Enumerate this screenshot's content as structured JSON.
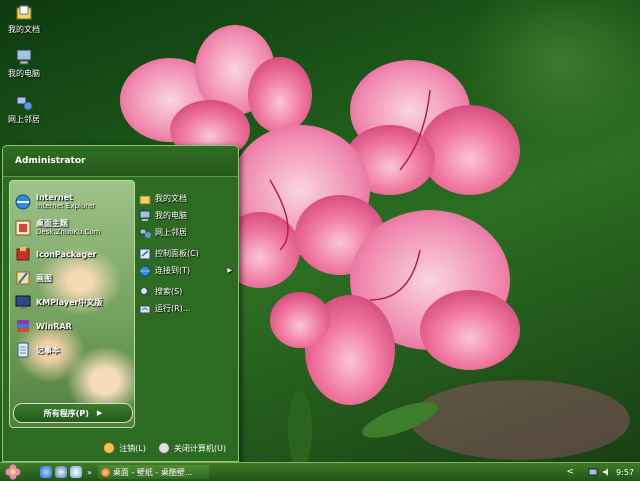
{
  "desktop": {
    "icons": [
      {
        "label": "我的文档",
        "icon": "my-documents-icon"
      },
      {
        "label": "我的电脑",
        "icon": "my-computer-icon"
      },
      {
        "label": "网上邻居",
        "icon": "network-places-icon"
      }
    ]
  },
  "start_menu": {
    "user_name": "Administrator",
    "pinned": [
      {
        "title": "Internet",
        "subtitle": "Internet Explorer",
        "icon": "internet-explorer-icon"
      },
      {
        "title": "桌面主题",
        "subtitle": "Desk.ZhuoKu.Com",
        "icon": "desktop-theme-icon"
      },
      {
        "title": "IconPackager",
        "subtitle": "",
        "icon": "iconpackager-icon"
      },
      {
        "title": "画图",
        "subtitle": "",
        "icon": "paint-icon"
      },
      {
        "title": "KMPlayer中文版",
        "subtitle": "",
        "icon": "kmplayer-icon"
      },
      {
        "title": "WinRAR",
        "subtitle": "",
        "icon": "winrar-icon"
      },
      {
        "title": "记事本",
        "subtitle": "",
        "icon": "notepad-icon"
      }
    ],
    "all_programs": "所有程序(P)",
    "right": {
      "my_documents": "我的文档",
      "my_computer": "我的电脑",
      "network_places": "网上邻居",
      "control_panel": "控制面板(C)",
      "connect_to": "连接到(T)",
      "search": "搜索(S)",
      "run": "运行(R)..."
    },
    "logoff": "注销(L)",
    "shutdown": "关闭计算机(U)"
  },
  "taskbar": {
    "task_title": "桌面 - 壁纸 - 桌酷壁...",
    "clock": "9:57",
    "tray_expand": "<",
    "ql_expand": "»"
  },
  "colors": {
    "menu_green": "#2d6a22",
    "taskbar_green": "#3e7a2a",
    "flower_pink": "#f07ca0"
  }
}
